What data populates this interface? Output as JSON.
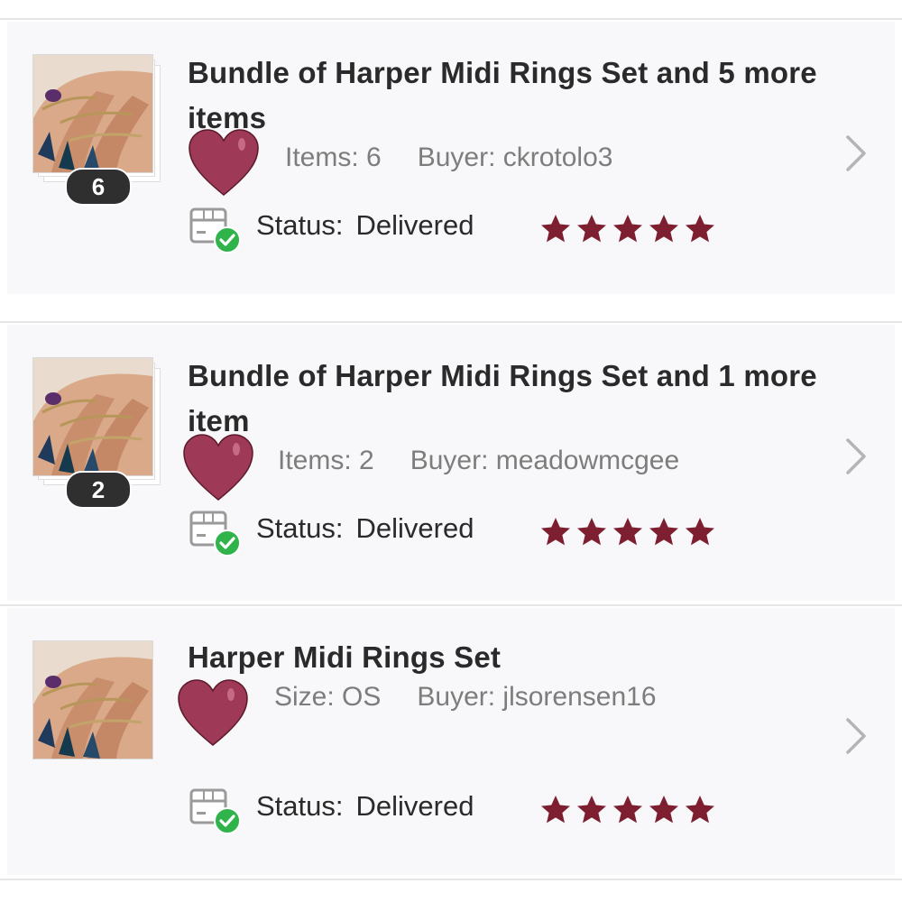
{
  "colors": {
    "star": "#7e1f31",
    "heart": "#9e3a57",
    "check": "#2fb34a",
    "badge": "#2f2f2f",
    "divider": "#e6e6e6"
  },
  "orders": [
    {
      "title": "Bundle of Harper Midi Rings Set and 5 more items",
      "count_badge": "6",
      "meta_label_1": "Items: 6",
      "meta_label_2": "Buyer: ckrotolo3",
      "status_label": "Status:",
      "status_value": "Delivered",
      "rating": 5,
      "icons": [
        "heart-icon",
        "package-delivered-icon",
        "chevron-right-icon",
        "star-icon"
      ]
    },
    {
      "title": "Bundle of Harper Midi Rings Set and 1 more item",
      "count_badge": "2",
      "meta_label_1": "Items: 2",
      "meta_label_2": "Buyer: meadowmcgee",
      "status_label": "Status:",
      "status_value": "Delivered",
      "rating": 5,
      "icons": [
        "heart-icon",
        "package-delivered-icon",
        "chevron-right-icon",
        "star-icon"
      ]
    },
    {
      "title": "Harper Midi Rings Set",
      "meta_label_1": "Size: OS",
      "meta_label_2": "Buyer: jlsorensen16",
      "status_label": "Status:",
      "status_value": "Delivered",
      "rating": 5,
      "icons": [
        "heart-icon",
        "package-delivered-icon",
        "chevron-right-icon",
        "star-icon"
      ]
    }
  ]
}
